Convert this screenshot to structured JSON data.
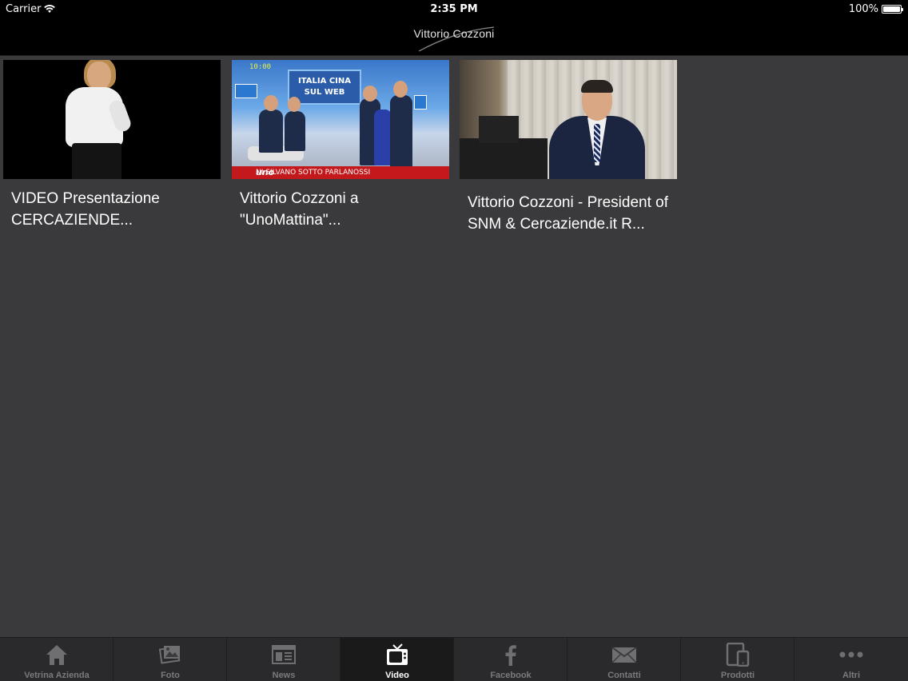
{
  "status_bar": {
    "carrier": "Carrier",
    "time": "2:35 PM",
    "battery": "100%"
  },
  "nav": {
    "title": "Vittorio Cozzoni"
  },
  "videos": [
    {
      "title": "VIDEO Presentazione CERCAZIENDE..."
    },
    {
      "title": "Vittorio Cozzoni a \"UnoMattina\"...",
      "thumb_banner": "ITALIA CINA SUL WEB",
      "thumb_clock": "10:00",
      "thumb_ticker_logo": "uno",
      "thumb_ticker": "NI SILVANO SOTTO PARLANOSSI"
    },
    {
      "title": "Vittorio Cozzoni - President of SNM & Cercaziende.it R..."
    }
  ],
  "tabs": [
    {
      "label": "Vetrina Azienda",
      "icon": "home-icon",
      "active": false
    },
    {
      "label": "Foto",
      "icon": "photos-icon",
      "active": false
    },
    {
      "label": "News",
      "icon": "news-icon",
      "active": false
    },
    {
      "label": "Video",
      "icon": "tv-icon",
      "active": true
    },
    {
      "label": "Facebook",
      "icon": "facebook-icon",
      "active": false
    },
    {
      "label": "Contatti",
      "icon": "mail-icon",
      "active": false
    },
    {
      "label": "Prodotti",
      "icon": "devices-icon",
      "active": false
    },
    {
      "label": "Altri",
      "icon": "more-icon",
      "active": false
    }
  ],
  "colors": {
    "background": "#3a3a3c",
    "bar": "#000000",
    "tab_bar": "#2a2a2c",
    "tab_active": "#1a1a1b",
    "tab_inactive_text": "#7a7a7c"
  }
}
